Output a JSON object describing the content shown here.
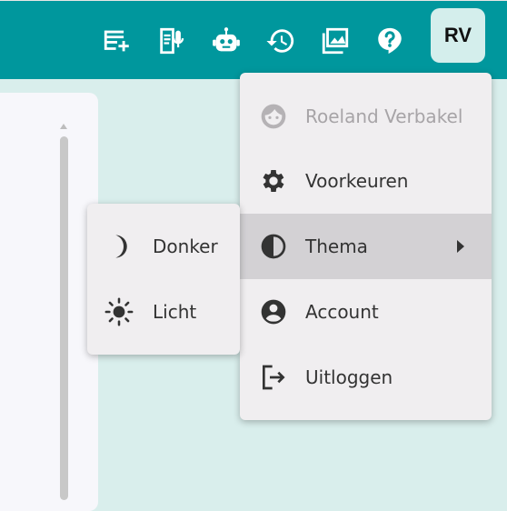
{
  "header": {
    "icons": [
      {
        "name": "new-note-icon"
      },
      {
        "name": "voice-note-icon"
      },
      {
        "name": "robot-icon"
      },
      {
        "name": "history-icon"
      },
      {
        "name": "gallery-icon"
      },
      {
        "name": "help-icon"
      }
    ],
    "avatar_initials": "RV",
    "colors": {
      "bar": "#00979d",
      "background": "#d9eeec"
    }
  },
  "user_menu": {
    "items": [
      {
        "label": "Roeland Verbakel",
        "icon": "face-icon",
        "disabled": true
      },
      {
        "label": "Voorkeuren",
        "icon": "gear-icon"
      },
      {
        "label": "Thema",
        "icon": "contrast-icon",
        "active": true,
        "has_submenu": true
      },
      {
        "label": "Account",
        "icon": "account-circle-icon"
      },
      {
        "label": "Uitloggen",
        "icon": "logout-icon"
      }
    ]
  },
  "theme_submenu": {
    "items": [
      {
        "label": "Donker",
        "icon": "moon-icon"
      },
      {
        "label": "Licht",
        "icon": "sun-icon"
      }
    ]
  }
}
